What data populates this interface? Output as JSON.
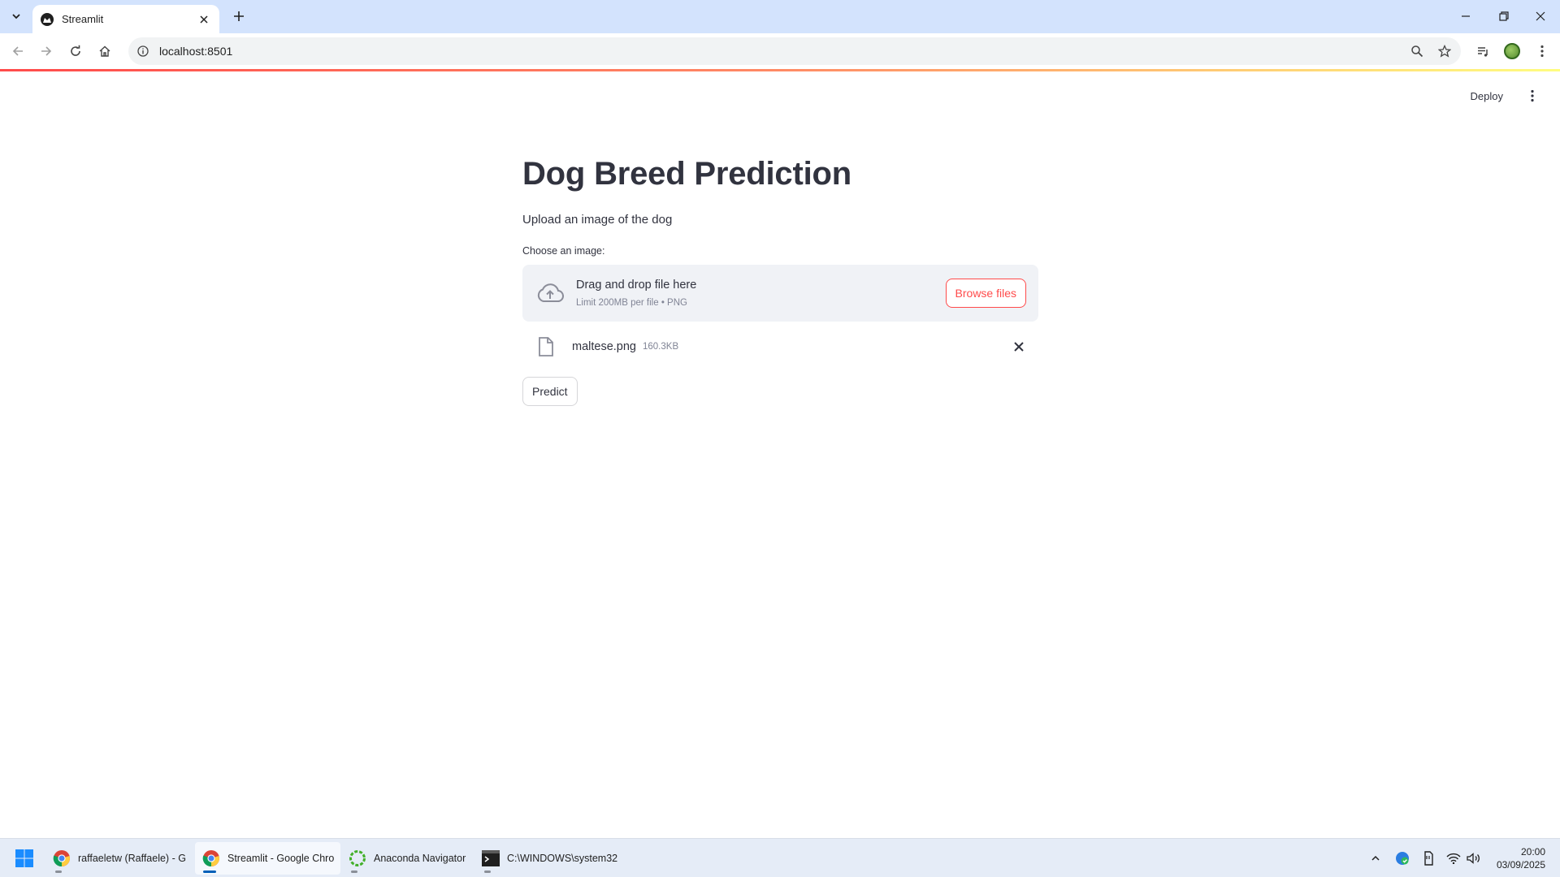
{
  "browser": {
    "tab_title": "Streamlit",
    "url": "localhost:8501"
  },
  "app": {
    "deploy_label": "Deploy",
    "title": "Dog Breed Prediction",
    "subtitle": "Upload an image of the dog",
    "uploader": {
      "label": "Choose an image:",
      "drop_title": "Drag and drop file here",
      "drop_limit": "Limit 200MB per file • PNG",
      "browse_label": "Browse files"
    },
    "uploaded_file": {
      "name": "maltese.png",
      "size": "160.3KB"
    },
    "predict_label": "Predict",
    "accent_color": "#ff4b4b"
  },
  "taskbar": {
    "apps": [
      {
        "label": "raffaeletw (Raffaele) - G",
        "icon": "chrome-icon"
      },
      {
        "label": "Streamlit - Google Chro",
        "icon": "chrome-icon"
      },
      {
        "label": "Anaconda Navigator",
        "icon": "anaconda-icon"
      },
      {
        "label": "C:\\WINDOWS\\system32",
        "icon": "terminal-icon"
      }
    ],
    "time": "20:00",
    "date": "03/09/2025"
  }
}
